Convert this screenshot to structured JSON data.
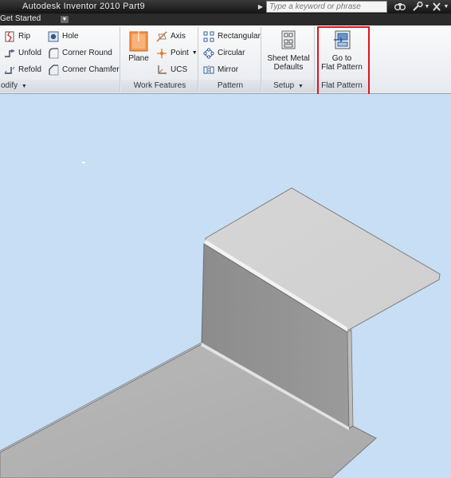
{
  "app": {
    "title": "Autodesk Inventor 2010    Part9"
  },
  "search": {
    "placeholder": "Type a keyword or phrase"
  },
  "tab": {
    "label": "Get Started"
  },
  "panels": {
    "modify": {
      "label": "odify",
      "rip": "Rip",
      "unfold": "Unfold",
      "refold": "Refold",
      "hole": "Hole",
      "corner_round": "Corner Round",
      "corner_chamfer": "Corner Chamfer"
    },
    "work_features": {
      "label": "Work Features",
      "plane": "Plane",
      "axis": "Axis",
      "point": "Point",
      "ucs": "UCS"
    },
    "pattern": {
      "label": "Pattern",
      "rectangular": "Rectangular",
      "circular": "Circular",
      "mirror": "Mirror"
    },
    "setup": {
      "label": "Setup",
      "sheet_metal_defaults_line1": "Sheet Metal",
      "sheet_metal_defaults_line2": "Defaults"
    },
    "flat_pattern": {
      "label": "Flat Pattern",
      "go_to_line1": "Go to",
      "go_to_line2": "Flat Pattern"
    }
  },
  "colors": {
    "highlight": "#e0141c",
    "viewport_bg": "#c7def4",
    "plane_icon": "#f08a3c"
  },
  "icons": [
    "help-icon",
    "wrench-icon",
    "x-icon",
    "rip-icon",
    "unfold-icon",
    "refold-icon",
    "hole-icon",
    "corner-round-icon",
    "corner-chamfer-icon",
    "plane-icon",
    "axis-icon",
    "point-icon",
    "ucs-icon",
    "rectangular-pattern-icon",
    "circular-pattern-icon",
    "mirror-icon",
    "sheet-metal-defaults-icon",
    "flat-pattern-icon"
  ]
}
